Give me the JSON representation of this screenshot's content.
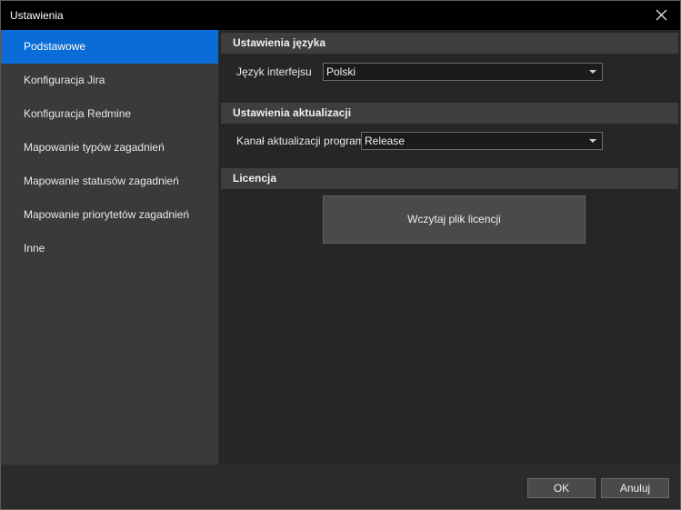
{
  "window": {
    "title": "Ustawienia",
    "close_icon": "close-icon"
  },
  "sidebar": {
    "items": [
      {
        "label": "Podstawowe",
        "active": true
      },
      {
        "label": "Konfiguracja Jira",
        "active": false
      },
      {
        "label": "Konfiguracja Redmine",
        "active": false
      },
      {
        "label": "Mapowanie typów zagadnień",
        "active": false
      },
      {
        "label": "Mapowanie statusów zagadnień",
        "active": false
      },
      {
        "label": "Mapowanie priorytetów zagadnień",
        "active": false
      },
      {
        "label": "Inne",
        "active": false
      }
    ]
  },
  "language_section": {
    "header": "Ustawienia języka",
    "label": "Język interfejsu",
    "value": "Polski"
  },
  "update_section": {
    "header": "Ustawienia aktualizacji",
    "label": "Kanał aktualizacji programu",
    "value": "Release"
  },
  "license_section": {
    "header": "Licencja",
    "button_label": "Wczytaj plik licencji"
  },
  "footer": {
    "ok_label": "OK",
    "cancel_label": "Anuluj"
  },
  "colors": {
    "accent": "#0a6cd6",
    "titlebar": "#000000",
    "sidebar_bg": "#3a3a3a",
    "content_bg": "#262626"
  }
}
